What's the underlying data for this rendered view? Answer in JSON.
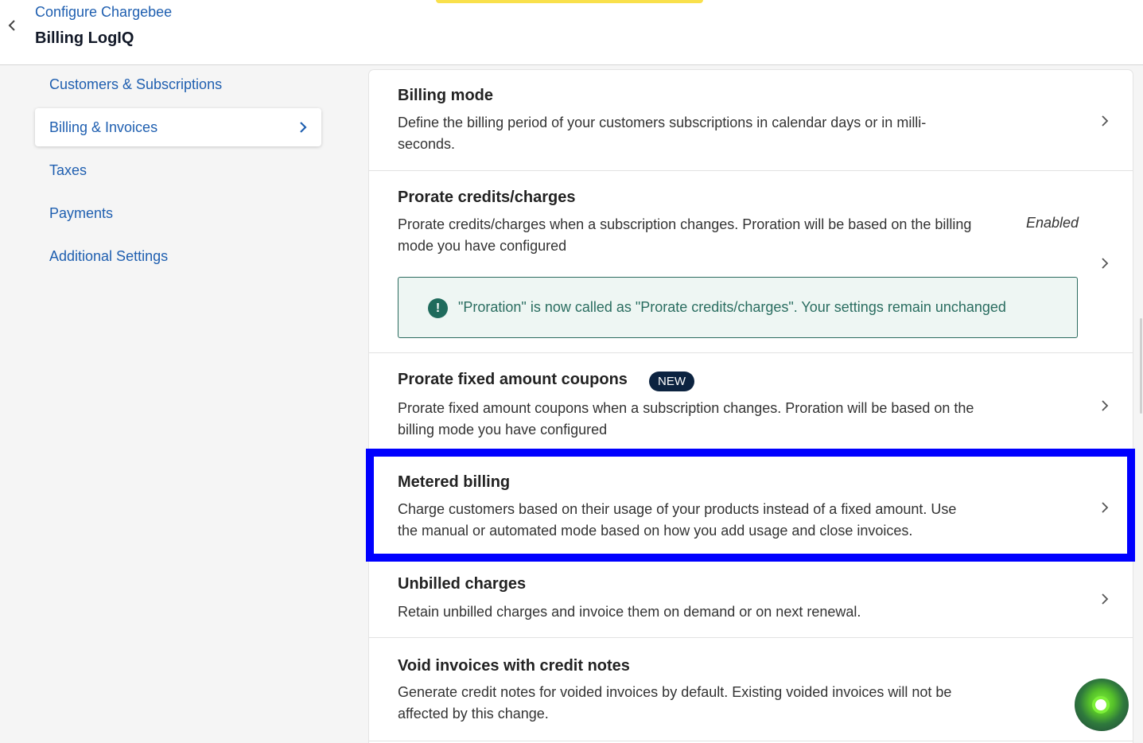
{
  "header": {
    "breadcrumb": "Configure Chargebee",
    "title": "Billing LogIQ"
  },
  "sidebar": {
    "items": [
      {
        "label": "Customers & Subscriptions",
        "active": false
      },
      {
        "label": "Billing & Invoices",
        "active": true
      },
      {
        "label": "Taxes",
        "active": false
      },
      {
        "label": "Payments",
        "active": false
      },
      {
        "label": "Additional Settings",
        "active": false
      }
    ]
  },
  "settings": [
    {
      "title": "Billing mode",
      "description": "Define the billing period of your customers subscriptions in calendar days or in milli-seconds."
    },
    {
      "title": "Prorate credits/charges",
      "description": "Prorate credits/charges when a subscription changes. Proration will be based on the billing mode you have configured",
      "status": "Enabled",
      "notice": "\"Proration\" is now called as \"Prorate credits/charges\". Your settings remain unchanged",
      "notice_icon": "exclamation-icon"
    },
    {
      "title": "Prorate fixed amount coupons",
      "badge": "NEW",
      "description": "Prorate fixed amount coupons when a subscription changes. Proration will be based on the billing mode you have configured"
    },
    {
      "title": "Metered billing",
      "description": "Charge customers based on their usage of your products instead of a fixed amount. Use the manual or automated mode based on how you add usage and close invoices."
    },
    {
      "title": "Unbilled charges",
      "description": "Retain unbilled charges and invoice them on demand or on next renewal."
    },
    {
      "title": "Void invoices with credit notes",
      "description": "Generate credit notes for voided invoices by default. Existing voided invoices will not be affected by this change."
    }
  ],
  "colors": {
    "link": "#1f5fb0",
    "badge_bg": "#0c2340",
    "notice_bg": "#eef6f3",
    "notice_border": "#2b6b5f",
    "highlight": "#0000ff",
    "accent_bar": "#f9e04b"
  }
}
